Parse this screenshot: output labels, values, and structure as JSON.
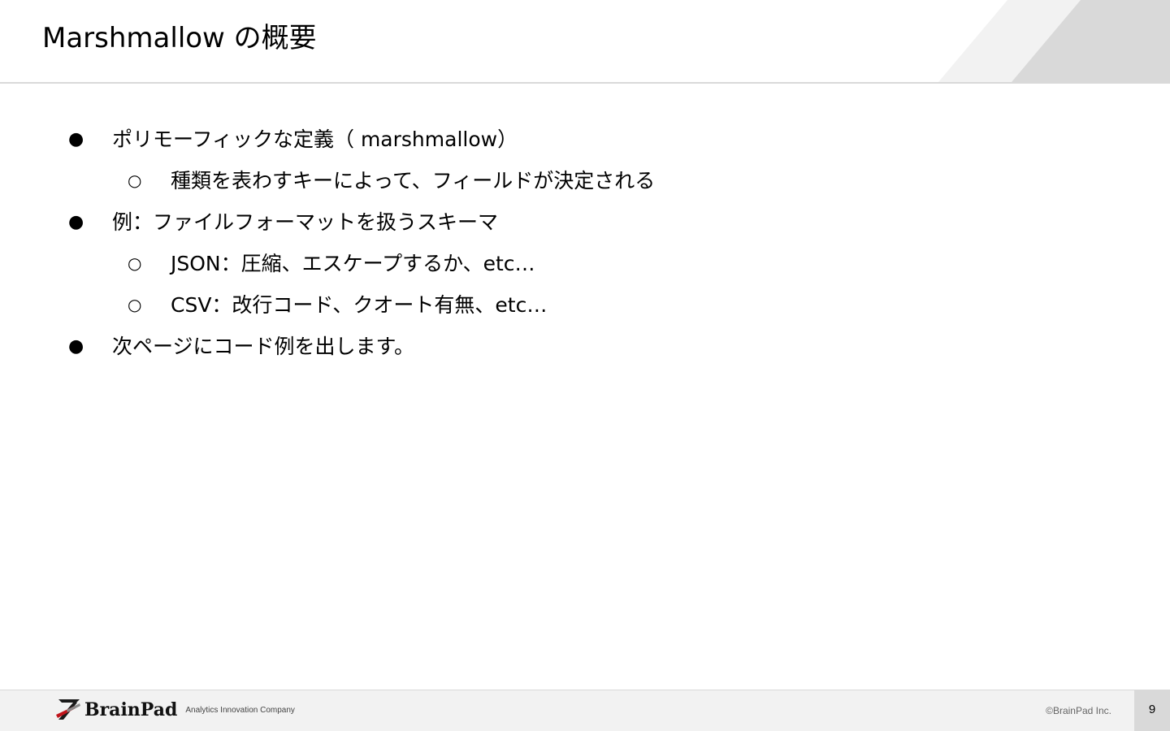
{
  "header": {
    "title": "Marshmallow の概要"
  },
  "bullets": [
    {
      "level": 1,
      "marker": "●",
      "text": "ポリモーフィックな定義（ marshmallow）"
    },
    {
      "level": 2,
      "marker": "○",
      "text": "種類を表わすキーによって、フィールドが決定される"
    },
    {
      "level": 1,
      "marker": "●",
      "text": "例：ファイルフォーマットを扱うスキーマ"
    },
    {
      "level": 2,
      "marker": "○",
      "text": "JSON：圧縮、エスケープするか、etc…"
    },
    {
      "level": 2,
      "marker": "○",
      "text": "CSV：改行コード、クオート有無、etc…"
    },
    {
      "level": 1,
      "marker": "●",
      "text": "次ページにコード例を出します。"
    }
  ],
  "footer": {
    "logo_text": "BrainPad",
    "tagline": "Analytics Innovation Company",
    "copyright": "©BrainPad Inc.",
    "page_number": "9"
  },
  "colors": {
    "header_rule": "#d9d9d9",
    "footer_background": "#f2f2f2",
    "page_number_box": "#d9d9d9",
    "logo_accent_red": "#c0141b",
    "logo_dark": "#1a1a1a"
  },
  "icons": {
    "logo_mark": "brainpad-logo-icon"
  }
}
